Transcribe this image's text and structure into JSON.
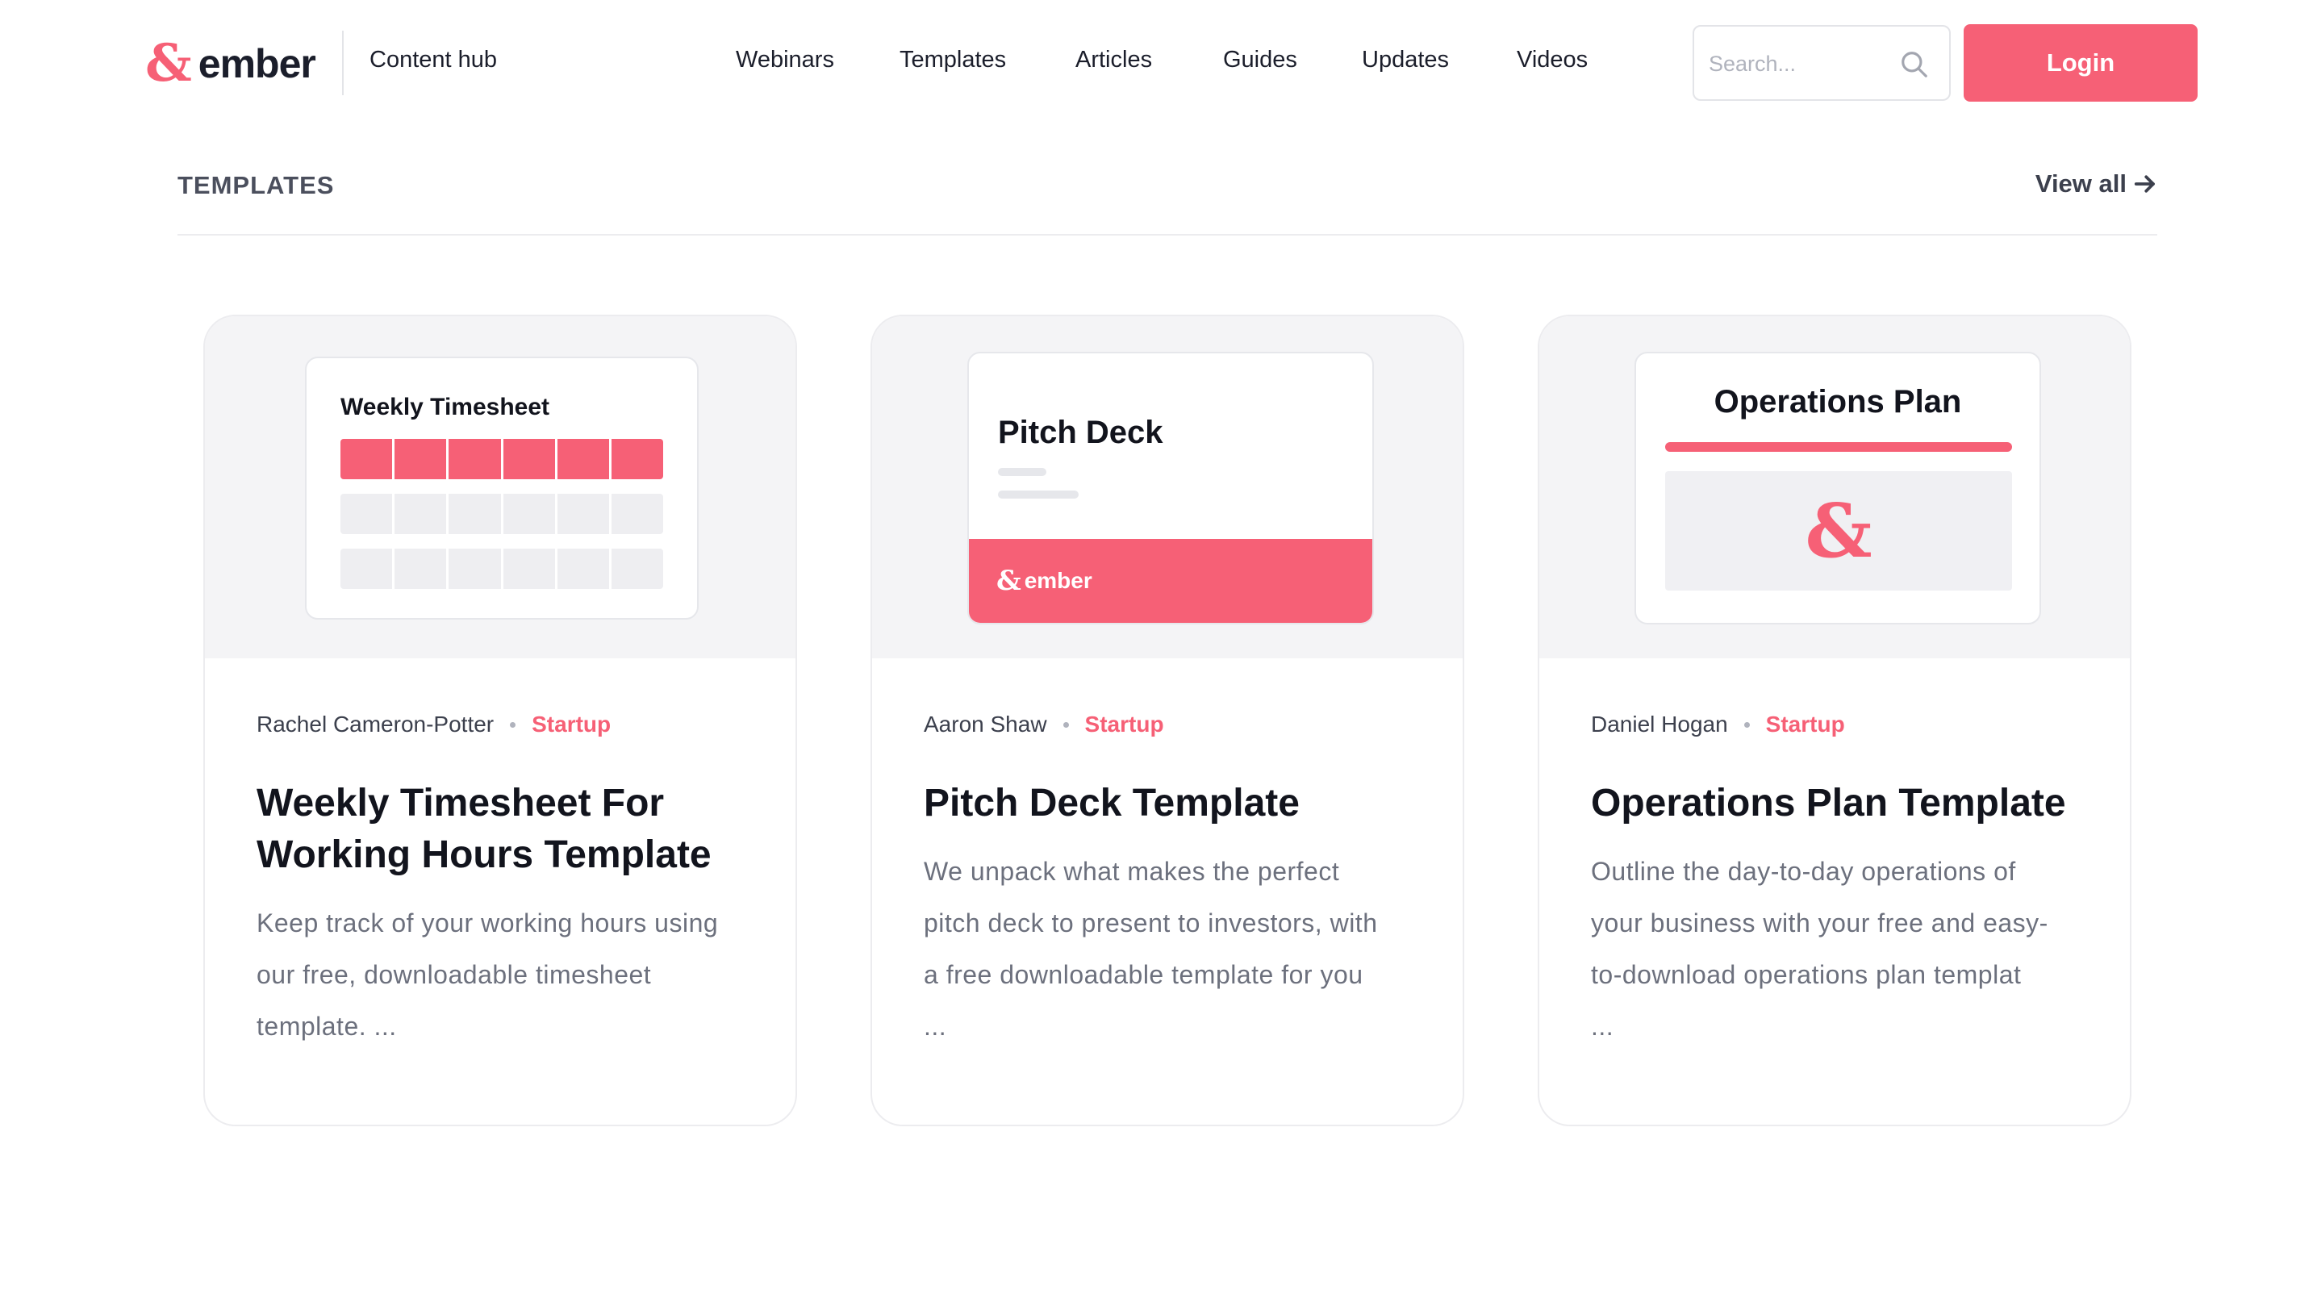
{
  "header": {
    "logo_symbol": "&",
    "logo_text": "ember",
    "hub_link": "Content hub",
    "nav": [
      "Webinars",
      "Templates",
      "Articles",
      "Guides",
      "Updates",
      "Videos"
    ],
    "search_placeholder": "Search...",
    "login_label": "Login"
  },
  "section": {
    "title": "TEMPLATES",
    "view_all": "View all"
  },
  "cards": [
    {
      "preview_title": "Weekly Timesheet",
      "author": "Rachel Cameron-Potter",
      "tag": "Startup",
      "title_line1": "Weekly Timesheet For",
      "title_line2": "Working Hours Template",
      "desc_lines": [
        "Keep track of your working hours using",
        "our free, downloadable timesheet",
        "template. ..."
      ]
    },
    {
      "preview_title": "Pitch Deck",
      "preview_brand": "ember",
      "author": "Aaron Shaw",
      "tag": "Startup",
      "title": "Pitch Deck Template",
      "desc_lines": [
        "We unpack what makes the perfect",
        "pitch deck to present to investors, with",
        "a free downloadable template for you",
        "..."
      ]
    },
    {
      "preview_title": "Operations Plan",
      "author": "Daniel Hogan",
      "tag": "Startup",
      "title": "Operations Plan Template",
      "desc_lines": [
        "Outline the day-to-day operations of",
        "your business with your free and easy-",
        "to-download operations plan templat",
        "..."
      ]
    }
  ],
  "colors": {
    "accent": "#f66076",
    "text_dark": "#12141d",
    "text_muted": "#6c707d",
    "preview_bg": "#f4f4f6"
  }
}
